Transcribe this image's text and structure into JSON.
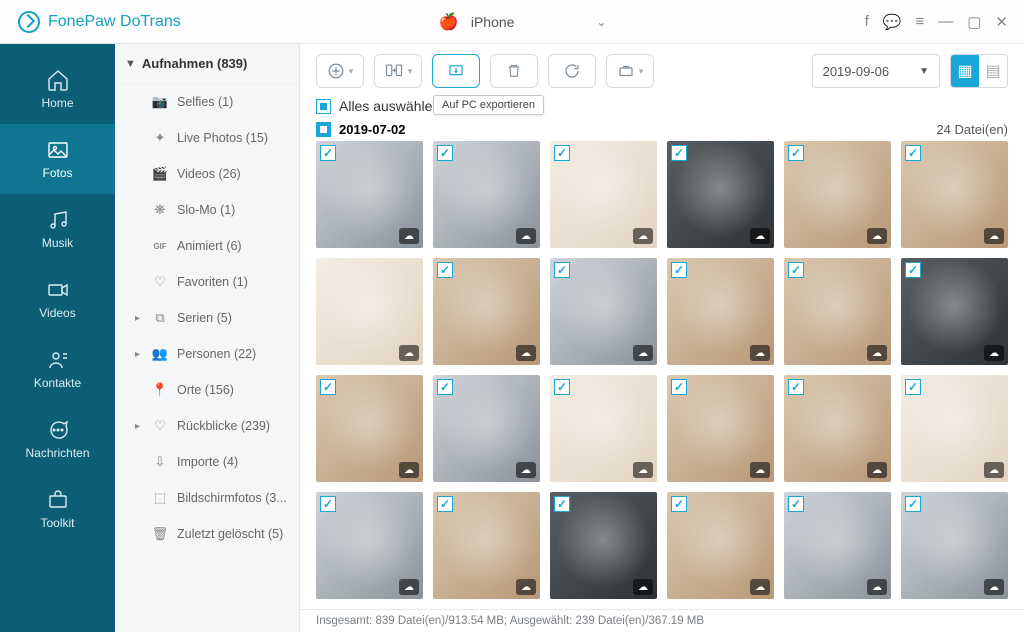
{
  "app": {
    "title": "FonePaw DoTrans"
  },
  "device": {
    "name": "iPhone"
  },
  "sidebar": {
    "items": [
      {
        "label": "Home"
      },
      {
        "label": "Fotos"
      },
      {
        "label": "Musik"
      },
      {
        "label": "Videos"
      },
      {
        "label": "Kontakte"
      },
      {
        "label": "Nachrichten"
      },
      {
        "label": "Toolkit"
      }
    ]
  },
  "sublist": {
    "header": "Aufnahmen (839)",
    "items": [
      {
        "label": "Selfies (1)",
        "icon": "camera"
      },
      {
        "label": "Live Photos (15)",
        "icon": "live"
      },
      {
        "label": "Videos (26)",
        "icon": "video"
      },
      {
        "label": "Slo-Mo (1)",
        "icon": "slomo"
      },
      {
        "label": "Animiert (6)",
        "icon": "gif"
      },
      {
        "label": "Favoriten (1)",
        "icon": "heart"
      },
      {
        "label": "Serien (5)",
        "icon": "burst",
        "expandable": true
      },
      {
        "label": "Personen (22)",
        "icon": "people",
        "expandable": true
      },
      {
        "label": "Orte (156)",
        "icon": "pin"
      },
      {
        "label": "Rückblicke (239)",
        "icon": "memories",
        "expandable": true
      },
      {
        "label": "Importe (4)",
        "icon": "import"
      },
      {
        "label": "Bildschirmfotos (3...",
        "icon": "screenshot"
      },
      {
        "label": "Zuletzt gelöscht (5)",
        "icon": "trash"
      }
    ]
  },
  "toolbar": {
    "export_tooltip": "Auf PC exportieren",
    "date_filter": "2019-09-06"
  },
  "content": {
    "select_all": "Alles auswählen (839)",
    "group_date": "2019-07-02",
    "file_count": "24 Datei(en)"
  },
  "statusbar": {
    "text": "Insgesamt: 839 Datei(en)/913.54 MB; Ausgewählt: 239 Datei(en)/367.19 MB"
  },
  "thumbs": [
    {
      "c": "cat"
    },
    {
      "c": "cat"
    },
    {
      "c": "light"
    },
    {
      "c": "dark"
    },
    {
      "c": ""
    },
    {
      "c": ""
    },
    {
      "c": "light",
      "nc": true
    },
    {
      "c": ""
    },
    {
      "c": "cat"
    },
    {
      "c": ""
    },
    {
      "c": ""
    },
    {
      "c": "dark"
    },
    {
      "c": ""
    },
    {
      "c": "cat"
    },
    {
      "c": "light"
    },
    {
      "c": ""
    },
    {
      "c": ""
    },
    {
      "c": "light"
    },
    {
      "c": "cat"
    },
    {
      "c": ""
    },
    {
      "c": "dark"
    },
    {
      "c": ""
    },
    {
      "c": "cat"
    },
    {
      "c": "cat"
    }
  ]
}
